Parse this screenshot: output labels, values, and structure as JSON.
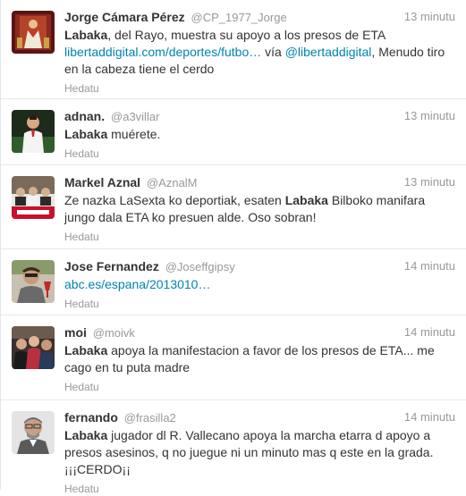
{
  "tweets": [
    {
      "fullname": "Jorge Cámara Pérez",
      "username": "@CP_1977_Jorge",
      "time": "13 minutu",
      "text": [
        {
          "t": "Labaka",
          "k": "b"
        },
        {
          "t": ", del Rayo, muestra su apoyo a los presos de ETA ",
          "k": "p"
        },
        {
          "t": "libertaddigital.com/deportes/futbo…",
          "k": "a"
        },
        {
          "t": " vía ",
          "k": "p"
        },
        {
          "t": "@libertaddigital",
          "k": "a"
        },
        {
          "t": ", Menudo tiro en la cabeza tiene el cerdo",
          "k": "p"
        }
      ],
      "action": "Hedatu",
      "avatar_icon": "religious-painting-avatar-icon"
    },
    {
      "fullname": "adnan.",
      "username": "@a3villar",
      "time": "13 minutu",
      "text": [
        {
          "t": "Labaka",
          "k": "b"
        },
        {
          "t": " muérete.",
          "k": "p"
        }
      ],
      "action": "Hedatu",
      "avatar_icon": "football-player-avatar-icon"
    },
    {
      "fullname": "Markel Aznal",
      "username": "@AznalM",
      "time": "13 minutu",
      "text": [
        {
          "t": "Ze nazka LaSexta ko deportiak, esaten ",
          "k": "p"
        },
        {
          "t": "Labaka",
          "k": "b"
        },
        {
          "t": " Bilboko manifara jungo dala ETA ko presuen alde. Oso sobran!",
          "k": "p"
        }
      ],
      "action": "Hedatu",
      "avatar_icon": "group-photo-avatar-icon"
    },
    {
      "fullname": "Jose Fernandez",
      "username": "@Joseffgipsy",
      "time": "14 minutu",
      "text": [
        {
          "t": "abc.es/espana/2013010…",
          "k": "a"
        }
      ],
      "action": "Hedatu",
      "avatar_icon": "person-with-glass-avatar-icon"
    },
    {
      "fullname": "moi",
      "username": "@moivk",
      "time": "14 minutu",
      "text": [
        {
          "t": "Labaka",
          "k": "b"
        },
        {
          "t": " apoya la manifestacion a favor de los presos de ETA... me cago en tu puta madre",
          "k": "p"
        }
      ],
      "action": "Hedatu",
      "avatar_icon": "friends-group-avatar-icon"
    },
    {
      "fullname": "fernando",
      "username": "@frasilla2",
      "time": "14 minutu",
      "text": [
        {
          "t": "Labaka",
          "k": "b"
        },
        {
          "t": " jugador dl R. Vallecano apoya la marcha etarra d apoyo a presos asesinos, q no juegue ni un minuto mas q este en la grada. ¡¡¡CERDO¡¡",
          "k": "p"
        }
      ],
      "action": "Hedatu",
      "avatar_icon": "portrait-avatar-icon"
    }
  ]
}
